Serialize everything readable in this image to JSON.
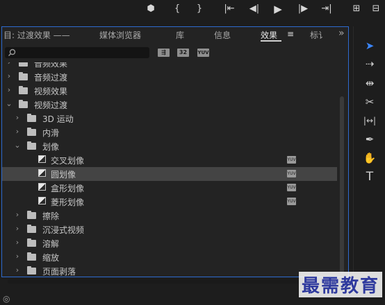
{
  "top_toolbar": {
    "icons": [
      "marker-icon",
      "mark-in-icon",
      "mark-out-icon",
      "go-to-in-icon",
      "step-back-icon",
      "play-icon",
      "step-forward-icon",
      "go-to-out-icon",
      "lift-icon"
    ],
    "glyphs": [
      "⬢",
      "{",
      "}",
      "|⇤",
      "◀|",
      "▶",
      "|▶",
      "⇥|",
      "⊞"
    ]
  },
  "panel": {
    "tabs": [
      {
        "label": "目: 过渡效果 ——",
        "active": false
      },
      {
        "label": "媒体浏览器",
        "active": false
      },
      {
        "label": "库",
        "active": false
      },
      {
        "label": "信息",
        "active": false
      },
      {
        "label": "效果",
        "active": true
      },
      {
        "label": "≡",
        "active": false
      },
      {
        "label": "标讠",
        "active": false
      }
    ],
    "overflow_glyph": "»",
    "search": {
      "placeholder": "",
      "icon": "search-icon"
    },
    "filters": [
      "accelerated-effects-icon",
      "32bit-icon",
      "yuv-icon"
    ],
    "filter_labels": [
      "⇶",
      "32",
      "YUV"
    ]
  },
  "tree": [
    {
      "label": "音频效果",
      "type": "folder",
      "expanded": false,
      "level": 0
    },
    {
      "label": "音频过渡",
      "type": "folder",
      "expanded": false,
      "level": 0
    },
    {
      "label": "视频效果",
      "type": "folder",
      "expanded": false,
      "level": 0
    },
    {
      "label": "视频过渡",
      "type": "folder",
      "expanded": true,
      "level": 0
    },
    {
      "label": "3D 运动",
      "type": "folder",
      "expanded": false,
      "level": 1
    },
    {
      "label": "内滑",
      "type": "folder",
      "expanded": false,
      "level": 1
    },
    {
      "label": "划像",
      "type": "folder",
      "expanded": true,
      "level": 1
    },
    {
      "label": "交叉划像",
      "type": "transition",
      "level": 2,
      "yuv": true
    },
    {
      "label": "圆划像",
      "type": "transition",
      "level": 2,
      "yuv": true,
      "selected": true
    },
    {
      "label": "盒形划像",
      "type": "transition",
      "level": 2,
      "yuv": true
    },
    {
      "label": "菱形划像",
      "type": "transition",
      "level": 2,
      "yuv": true
    },
    {
      "label": "擦除",
      "type": "folder",
      "expanded": false,
      "level": 1
    },
    {
      "label": "沉浸式视频",
      "type": "folder",
      "expanded": false,
      "level": 1
    },
    {
      "label": "溶解",
      "type": "folder",
      "expanded": false,
      "level": 1
    },
    {
      "label": "缩放",
      "type": "folder",
      "expanded": false,
      "level": 1
    },
    {
      "label": "页面剥落",
      "type": "folder",
      "expanded": false,
      "level": 1
    }
  ],
  "tools": {
    "names": [
      "selection-tool-icon",
      "track-select-icon",
      "ripple-edit-icon",
      "razor-icon",
      "slip-icon",
      "pen-icon",
      "hand-icon",
      "type-icon"
    ],
    "glyphs": [
      "➤",
      "⇢",
      "⇹",
      "✂",
      "|↔|",
      "✒",
      "✋",
      "T"
    ]
  },
  "watermark": "最需教育"
}
